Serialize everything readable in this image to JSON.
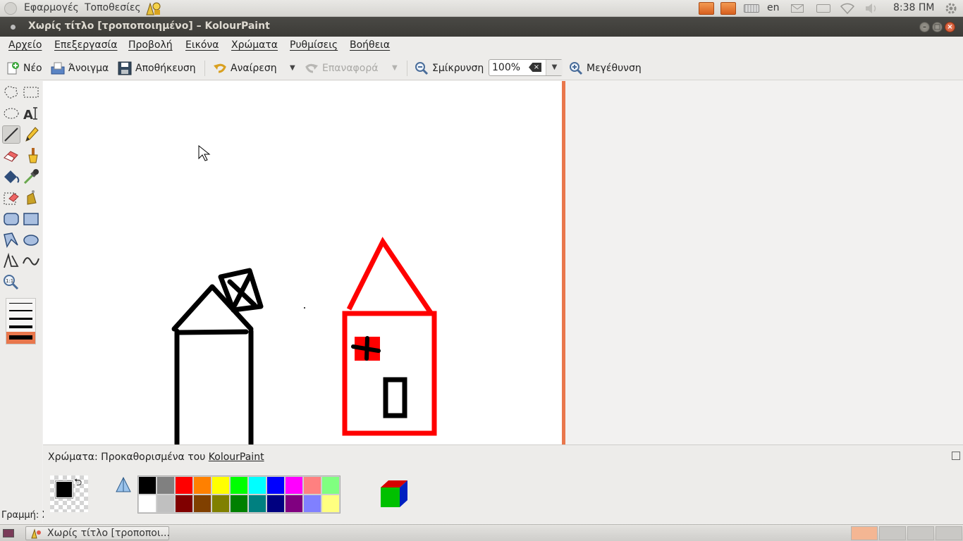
{
  "panel": {
    "menus": [
      "Εφαρμογές",
      "Τοποθεσίες"
    ],
    "language": "en",
    "clock": "8:38 ΠΜ"
  },
  "window": {
    "title": "Χωρίς τίτλο [τροποποιημένο] – KolourPaint"
  },
  "menubar": {
    "items": [
      "Αρχείο",
      "Επεξεργασία",
      "Προβολή",
      "Εικόνα",
      "Χρώματα",
      "Ρυθμίσεις",
      "Βοήθεια"
    ]
  },
  "toolbar": {
    "new_label": "Νέο",
    "open_label": "Άνοιγμα",
    "save_label": "Αποθήκευση",
    "undo_label": "Αναίρεση",
    "redo_label": "Επαναφορά",
    "zoom_out_label": "Σμίκρυνση",
    "zoom_value": "100%",
    "zoom_in_label": "Μεγέθυνση"
  },
  "tools": {
    "icons": [
      "free-form-select-icon",
      "rect-select-icon",
      "ellipse-select-icon",
      "text-tool-icon",
      "line-tool-icon",
      "pen-tool-icon",
      "eraser-tool-icon",
      "brush-tool-icon",
      "flood-fill-icon",
      "color-picker-icon",
      "color-eraser-icon",
      "spraycan-icon",
      "rounded-rect-icon",
      "rectangle-icon",
      "polygon-icon",
      "ellipse-icon",
      "polyline-icon",
      "curve-icon",
      "zoom-tool-icon"
    ],
    "active": "line-tool-icon"
  },
  "colors": {
    "dock_title_prefix": "Χρώματα: Προκαθορισμένα του ",
    "dock_title_app": "KolourPaint",
    "foreground": "#000000",
    "background": "transparent",
    "palette_row1": [
      "#000000",
      "#808080",
      "#ff0000",
      "#ff8000",
      "#ffff00",
      "#00ff00",
      "#00ffff",
      "#0000ff",
      "#ff00ff",
      "#ff8080",
      "#80ff80"
    ],
    "palette_row2": [
      "#ffffff",
      "#c0c0c0",
      "#800000",
      "#804000",
      "#808000",
      "#008000",
      "#008080",
      "#000080",
      "#800080",
      "#8080ff",
      "#ffff80"
    ]
  },
  "status": {
    "text": "Γραμμή: Σ"
  },
  "taskbar": {
    "task_label": "Χωρίς τίτλο [τροποποι..."
  },
  "accent": {
    "canvas_edge": "#e9774c",
    "titlebar": "#3c3b37"
  }
}
